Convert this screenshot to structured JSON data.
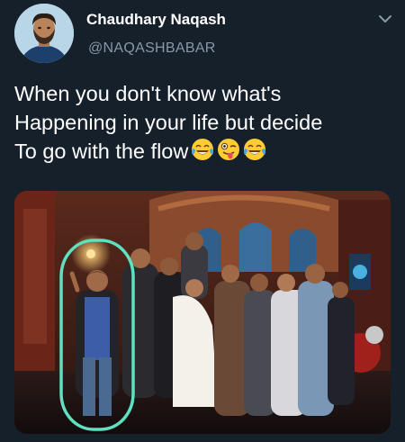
{
  "tweet": {
    "author_name": "Chaudhary Naqash",
    "author_handle": "@NAQASHBABAR",
    "text_lines": [
      "When you don't know what's",
      "Happening in your life but decide",
      "To go with the flow"
    ],
    "emojis": [
      "tears-of-joy-emoji",
      "winking-tongue-emoji",
      "tears-of-joy-emoji"
    ]
  },
  "icons": {
    "menu": "chevron-down-icon"
  },
  "colors": {
    "background": "#15202b",
    "secondary_text": "#8899a6",
    "highlight_ring": "#5fe0c0"
  }
}
